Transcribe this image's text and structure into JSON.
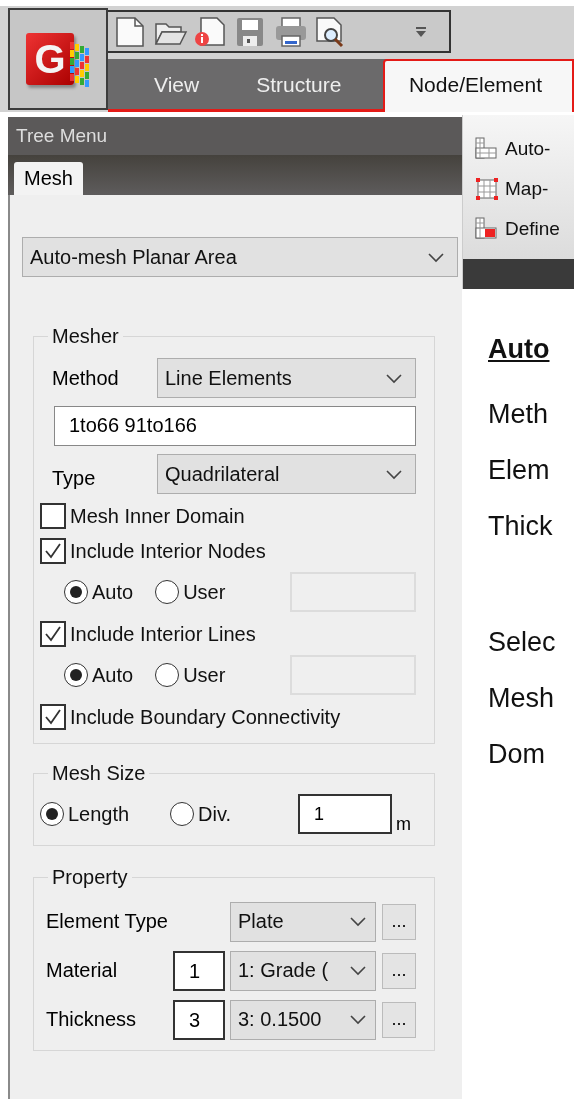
{
  "app_logo": {
    "letter": "G"
  },
  "ribbon_tabs": [
    {
      "label": "View",
      "selected": false
    },
    {
      "label": "Structure",
      "selected": false
    },
    {
      "label": "Node/Element",
      "selected": true
    }
  ],
  "ribbon_panel": {
    "items": [
      {
        "kind": "auto",
        "label": "Auto-"
      },
      {
        "kind": "map",
        "label": "Map-"
      },
      {
        "kind": "define",
        "label": "Define"
      }
    ]
  },
  "tree_menu": {
    "title": "Tree Menu",
    "tabs": [
      {
        "label": "Mesh",
        "selected": true
      }
    ],
    "mode": "Auto-mesh Planar Area",
    "mesher": {
      "title": "Mesher",
      "method_label": "Method",
      "method": "Line Elements",
      "selection": "1to66 91to166",
      "type_label": "Type",
      "type": "Quadrilateral",
      "options": [
        {
          "kind": "checkbox",
          "label": "Mesh Inner Domain",
          "checked": false
        },
        {
          "kind": "checkbox",
          "label": "Include Interior Nodes",
          "checked": true
        },
        {
          "kind": "radios",
          "choices": [
            {
              "label": "Auto",
              "selected": true
            },
            {
              "label": "User",
              "selected": false
            }
          ]
        },
        {
          "kind": "checkbox",
          "label": "Include Interior Lines",
          "checked": true
        },
        {
          "kind": "radios",
          "choices": [
            {
              "label": "Auto",
              "selected": true
            },
            {
              "label": "User",
              "selected": false
            }
          ]
        },
        {
          "kind": "checkbox",
          "label": "Include Boundary Connectivity",
          "checked": true
        }
      ]
    },
    "mesh_size": {
      "title": "Mesh Size",
      "choices": [
        {
          "label": "Length",
          "selected": true
        },
        {
          "label": "Div.",
          "selected": false
        }
      ],
      "value": "1",
      "unit": "m"
    },
    "property": {
      "title": "Property",
      "rows": [
        {
          "label": "Element Type",
          "value": "Plate",
          "more": "..."
        },
        {
          "label": "Material",
          "number": "1",
          "value": "1: Grade (",
          "more": "..."
        },
        {
          "label": "Thickness",
          "number": "3",
          "value": "3: 0.1500",
          "more": "..."
        }
      ]
    }
  },
  "slide_text": {
    "heading": "Auto",
    "paragraphs": [
      {
        "lines": [
          "Meth",
          "Elem",
          "Thick"
        ]
      },
      {
        "lines": [
          "Selec",
          "Mesh",
          "Dom"
        ]
      }
    ]
  }
}
